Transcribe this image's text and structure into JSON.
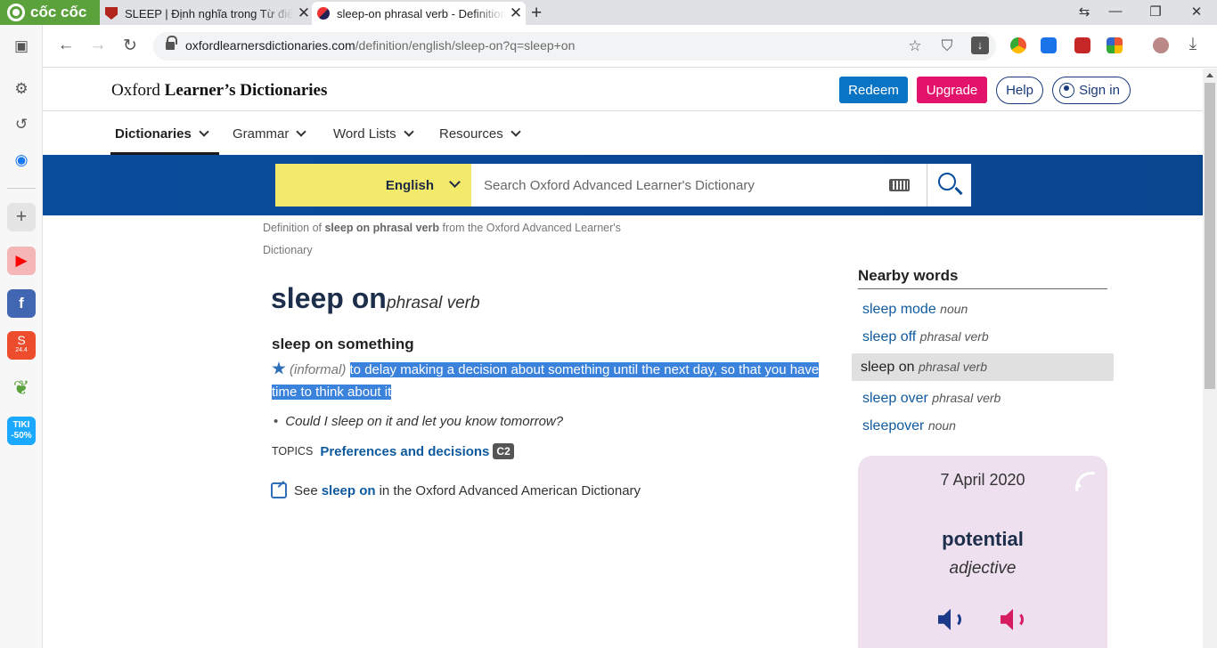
{
  "browser": {
    "brand": "cốc cốc",
    "tabs": [
      {
        "title": "SLEEP | Định nghĩa trong Từ điển tiếng Anh Cambridge"
      },
      {
        "title": "sleep-on phrasal verb - Definition"
      }
    ],
    "url_domain": "oxfordlearnersdictionaries.com",
    "url_path": "/definition/english/sleep-on?q=sleep+on"
  },
  "site": {
    "title_prefix": "Oxford ",
    "title_main": "Learner’s Dictionaries",
    "redeem": "Redeem",
    "upgrade": "Upgrade",
    "help": "Help",
    "signin": "Sign in"
  },
  "nav": [
    "Dictionaries",
    "Grammar",
    "Word Lists",
    "Resources"
  ],
  "search": {
    "language": "English",
    "placeholder": "Search Oxford Advanced Learner's Dictionary"
  },
  "entry": {
    "crumb_prefix": "Definition of ",
    "crumb_term": "sleep on phrasal verb",
    "crumb_suffix": " from the Oxford Advanced Learner's Dictionary",
    "headword": "sleep on",
    "pos": "phrasal verb",
    "phrase": "sleep on something",
    "grammar": "(informal)",
    "definition_a": "to delay making a decision about something until the next day, so that you have",
    "definition_b": "time to think about it",
    "example": "Could I sleep on it and let you know tomorrow?",
    "topics_label": "TOPICS",
    "topic": "Preferences and decisions",
    "level": "C2",
    "see_prefix": "See",
    "see_term": "sleep on",
    "see_suffix": "in the Oxford Advanced American Dictionary"
  },
  "nearby": {
    "title": "Nearby words",
    "items": [
      {
        "word": "sleep mode",
        "pos": "noun"
      },
      {
        "word": "sleep off",
        "pos": "phrasal verb"
      },
      {
        "word": "sleep on",
        "pos": "phrasal verb"
      },
      {
        "word": "sleep over",
        "pos": "phrasal verb"
      },
      {
        "word": "sleepover",
        "pos": "noun"
      }
    ]
  },
  "wotd": {
    "date": "7 April 2020",
    "word": "potential",
    "pos": "adjective"
  },
  "sidebar": {
    "tiki_line1": "TIKI",
    "tiki_line2": "-50%",
    "shopee_badge": "24.4"
  },
  "colors": {
    "brand_green": "#5ba23d",
    "oxford_blue": "#0a4d9c",
    "redeem": "#0a74c4",
    "upgrade": "#e3136c",
    "lang_yellow": "#f3e96b",
    "wotd_bg": "#efe0f0",
    "selection": "#3b82dc"
  },
  "icons": [
    "back-arrow-icon",
    "forward-arrow-icon",
    "reload-icon",
    "lock-icon",
    "star-icon",
    "shield-icon",
    "download-icon",
    "keyboard-icon",
    "search-icon",
    "external-link-icon",
    "rss-icon",
    "speaker-icon"
  ]
}
